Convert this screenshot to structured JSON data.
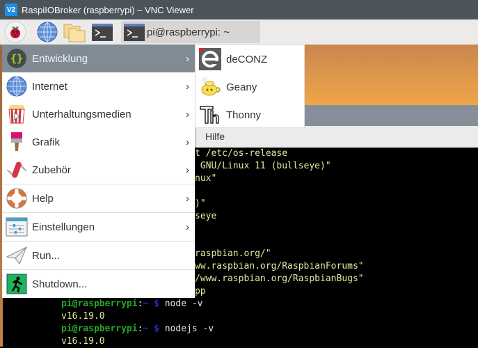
{
  "window": {
    "title": "RaspiIOBroker (raspberrypi) – VNC Viewer",
    "logo": "V2"
  },
  "panel": {
    "task_label": "pi@raspberrypi: ~",
    "icons": [
      "raspberry-menu-icon",
      "browser-globe-icon",
      "file-manager-folder-icon",
      "terminal-icon"
    ]
  },
  "terminal_window": {
    "menu": {
      "help": "Hilfe"
    },
    "lines": [
      {
        "text": "t /etc/os-release"
      },
      {
        "text": " GNU/Linux 11 (bullseye)\""
      },
      {
        "text": "nux\""
      },
      {
        "text": ""
      },
      {
        "text": ")\""
      },
      {
        "text": "seye"
      },
      {
        "text": ""
      },
      {
        "text": ""
      },
      {
        "text": "raspbian.org/\""
      },
      {
        "text": "ww.raspbian.org/RaspbianForums\""
      },
      {
        "text": "/www.raspbian.org/RaspbianBugs\""
      },
      {
        "text": "pp"
      }
    ],
    "prompts": [
      {
        "user": "pi@raspberrypi",
        "sep": ":",
        "path": "~",
        "dollar": "$",
        "cmd": " node -v",
        "output": "v16.19.0"
      },
      {
        "user": "pi@raspberrypi",
        "sep": ":",
        "path": "~",
        "dollar": "$",
        "cmd": " nodejs -v",
        "output": "v16.19.0"
      }
    ]
  },
  "menu": {
    "items": [
      {
        "label": "Entwicklung",
        "icon": "code-braces-icon",
        "submenu": true,
        "active": true
      },
      {
        "label": "Internet",
        "icon": "globe-icon",
        "submenu": true
      },
      {
        "label": "Unterhaltungsmedien",
        "icon": "popcorn-icon",
        "submenu": true
      },
      {
        "label": "Grafik",
        "icon": "paintbrush-icon",
        "submenu": true
      },
      {
        "label": "Zubehör",
        "icon": "pocketknife-icon",
        "submenu": true
      },
      {
        "label": "Help",
        "icon": "lifebuoy-icon",
        "submenu": true
      },
      {
        "label": "Einstellungen",
        "icon": "settings-sliders-icon",
        "submenu": true
      },
      {
        "label": "Run...",
        "icon": "paper-plane-icon",
        "submenu": false
      },
      {
        "label": "Shutdown...",
        "icon": "exit-running-man-icon",
        "submenu": false
      }
    ],
    "chevron": "›"
  },
  "submenu": {
    "items": [
      {
        "label": "deCONZ",
        "icon": "deconz-icon"
      },
      {
        "label": "Geany",
        "icon": "geany-teapot-icon"
      },
      {
        "label": "Thonny",
        "icon": "thonny-icon"
      }
    ]
  }
}
